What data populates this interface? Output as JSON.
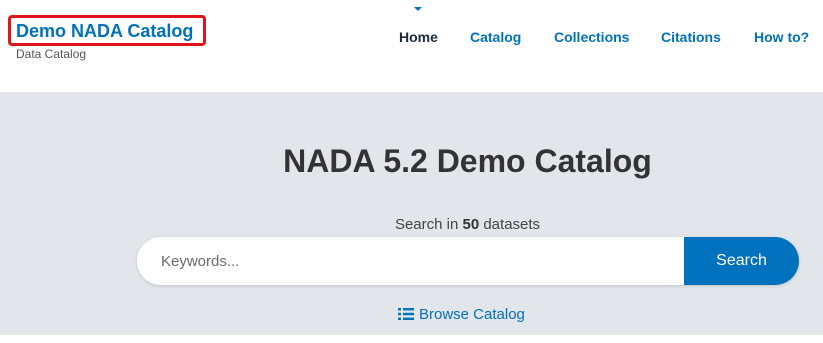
{
  "brand": {
    "title": "Demo NADA Catalog",
    "subtitle": "Data Catalog",
    "highlight_color": "#e0141b"
  },
  "nav": {
    "items": [
      {
        "label": "Home",
        "active": true
      },
      {
        "label": "Catalog",
        "active": false
      },
      {
        "label": "Collections",
        "active": false
      },
      {
        "label": "Citations",
        "active": false
      },
      {
        "label": "How to?",
        "active": false
      }
    ]
  },
  "hero": {
    "title": "NADA 5.2 Demo Catalog",
    "search_prefix": "Search in",
    "dataset_count": "50",
    "search_suffix": "datasets",
    "search_placeholder": "Keywords...",
    "search_button": "Search",
    "browse_label": "Browse Catalog",
    "browse_icon": "list-icon"
  },
  "colors": {
    "accent": "#0071bc",
    "hero_background": "#e2e5ea",
    "active_nav": "#1c2b3a"
  }
}
